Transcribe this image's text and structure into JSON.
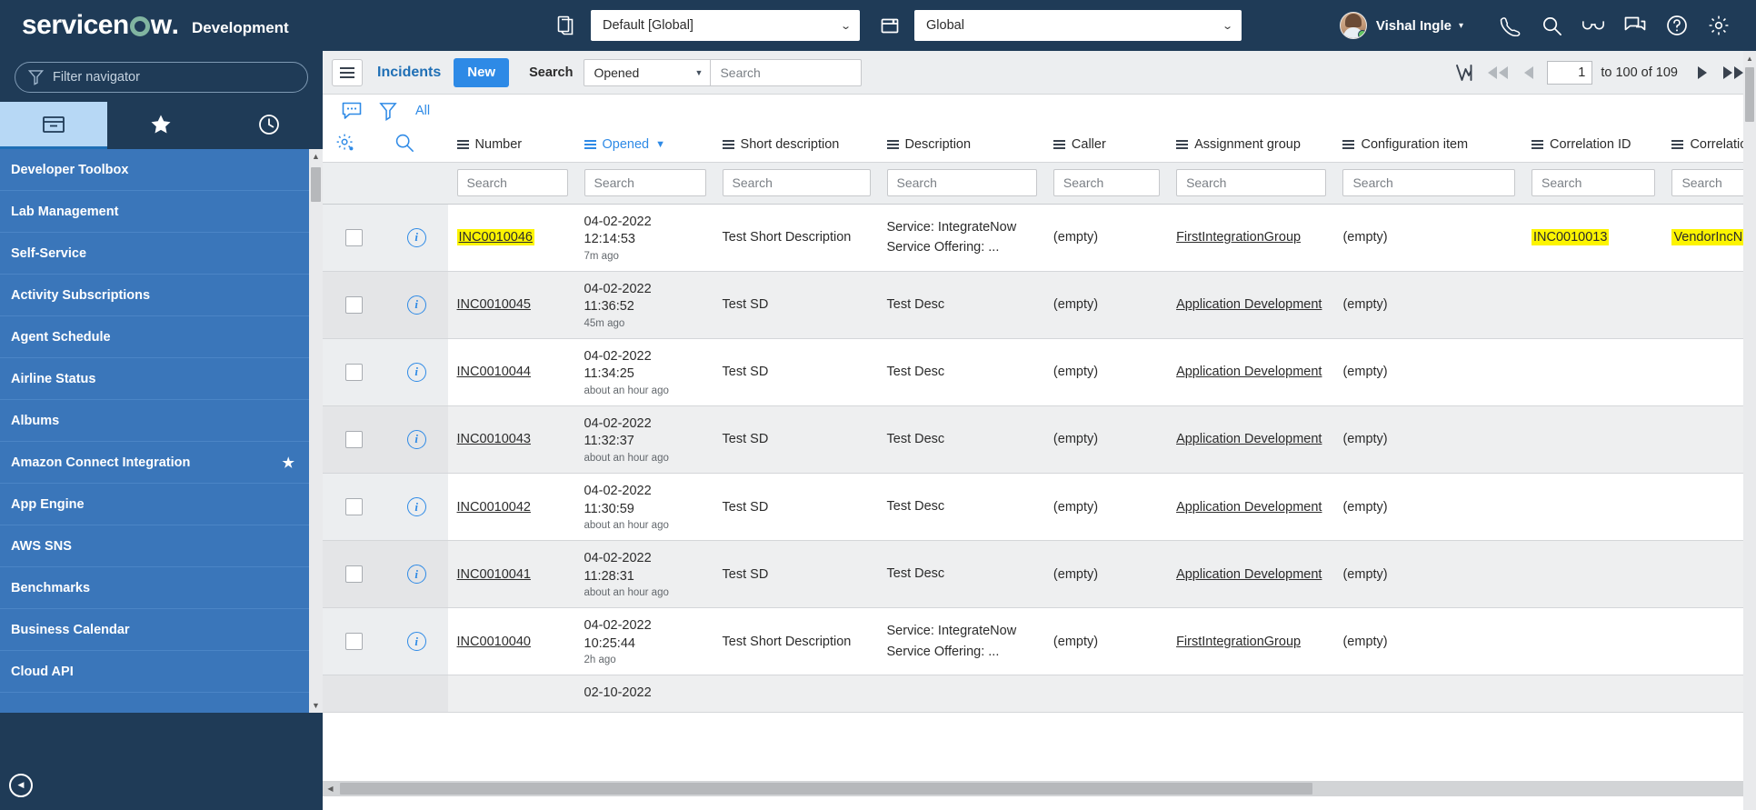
{
  "banner": {
    "brand": "servicenow",
    "instance_label": "Development",
    "app_picker": {
      "value": "Default [Global]",
      "icon": "copy-pages-icon"
    },
    "scope_picker": {
      "value": "Global",
      "icon": "window-icon"
    },
    "user": {
      "name": "Vishal Ingle",
      "presence": "online"
    },
    "icons": [
      "phone-icon",
      "search-icon",
      "glasses-icon",
      "conversation-icon",
      "help-icon",
      "gear-icon"
    ]
  },
  "sidebar": {
    "filter_placeholder": "Filter navigator",
    "tabs": [
      {
        "name": "all-applications",
        "icon": "box-icon",
        "active": true
      },
      {
        "name": "favorites",
        "icon": "star-icon",
        "active": false
      },
      {
        "name": "history",
        "icon": "clock-icon",
        "active": false
      }
    ],
    "items": [
      {
        "label": "Developer Toolbox",
        "favorite": false
      },
      {
        "label": "Lab Management",
        "favorite": false
      },
      {
        "label": "Self-Service",
        "favorite": false
      },
      {
        "label": "Activity Subscriptions",
        "favorite": false
      },
      {
        "label": "Agent Schedule",
        "favorite": false
      },
      {
        "label": "Airline Status",
        "favorite": false
      },
      {
        "label": "Albums",
        "favorite": false
      },
      {
        "label": "Amazon Connect Integration",
        "favorite": true
      },
      {
        "label": "App Engine",
        "favorite": false
      },
      {
        "label": "AWS SNS",
        "favorite": false
      },
      {
        "label": "Benchmarks",
        "favorite": false
      },
      {
        "label": "Business Calendar",
        "favorite": false
      },
      {
        "label": "Cloud API",
        "favorite": false
      }
    ],
    "collapse_label": "◀"
  },
  "toolbar": {
    "menu_icon": "hamburger-icon",
    "title": "Incidents",
    "new_label": "New",
    "search_label": "Search",
    "search_field": "Opened",
    "search_placeholder": "Search",
    "search_value": ""
  },
  "pagination": {
    "chart_icon": "run-chart-icon",
    "page_value": "1",
    "range_text": "to 100 of 109"
  },
  "subbar": {
    "comment_icon": "comment-icon",
    "filter_icon": "funnel-icon",
    "breadcrumb": "All",
    "gear_icon": "personalize-gear-icon",
    "search_icon": "search-icon"
  },
  "table": {
    "columns": [
      {
        "key": "number",
        "label": "Number",
        "sorted": false
      },
      {
        "key": "opened",
        "label": "Opened",
        "sorted": true,
        "sort_dir": "desc"
      },
      {
        "key": "short",
        "label": "Short description",
        "sorted": false
      },
      {
        "key": "desc",
        "label": "Description",
        "sorted": false
      },
      {
        "key": "caller",
        "label": "Caller",
        "sorted": false
      },
      {
        "key": "ag",
        "label": "Assignment group",
        "sorted": false
      },
      {
        "key": "ci",
        "label": "Configuration item",
        "sorted": false
      },
      {
        "key": "cid",
        "label": "Correlation ID",
        "sorted": false
      },
      {
        "key": "cdisp",
        "label": "Correlation display",
        "sorted": false
      }
    ],
    "filter_placeholder": "Search",
    "rows": [
      {
        "number": "INC0010046",
        "number_highlighted": true,
        "date": "04-02-2022",
        "time": "12:14:53",
        "ago": "7m ago",
        "short": "Test Short Description",
        "desc": "Service: IntegrateNow Service Offering: ...",
        "caller": "(empty)",
        "ag": "FirstIntegrationGroup",
        "ag_link": true,
        "ci": "(empty)",
        "cid": "INC0010013",
        "cid_highlighted": true,
        "cdisp": "VendorIncNumber",
        "cdisp_highlighted": true
      },
      {
        "number": "INC0010045",
        "number_highlighted": false,
        "date": "04-02-2022",
        "time": "11:36:52",
        "ago": "45m ago",
        "short": "Test SD",
        "desc": "Test Desc",
        "caller": "(empty)",
        "ag": "Application Development",
        "ag_link": true,
        "ci": "(empty)",
        "cid": "",
        "cdisp": ""
      },
      {
        "number": "INC0010044",
        "number_highlighted": false,
        "date": "04-02-2022",
        "time": "11:34:25",
        "ago": "about an hour ago",
        "short": "Test SD",
        "desc": "Test Desc",
        "caller": "(empty)",
        "ag": "Application Development",
        "ag_link": true,
        "ci": "(empty)",
        "cid": "",
        "cdisp": ""
      },
      {
        "number": "INC0010043",
        "number_highlighted": false,
        "date": "04-02-2022",
        "time": "11:32:37",
        "ago": "about an hour ago",
        "short": "Test SD",
        "desc": "Test Desc",
        "caller": "(empty)",
        "ag": "Application Development",
        "ag_link": true,
        "ci": "(empty)",
        "cid": "",
        "cdisp": ""
      },
      {
        "number": "INC0010042",
        "number_highlighted": false,
        "date": "04-02-2022",
        "time": "11:30:59",
        "ago": "about an hour ago",
        "short": "Test SD",
        "desc": "Test Desc",
        "caller": "(empty)",
        "ag": "Application Development",
        "ag_link": true,
        "ci": "(empty)",
        "cid": "",
        "cdisp": ""
      },
      {
        "number": "INC0010041",
        "number_highlighted": false,
        "date": "04-02-2022",
        "time": "11:28:31",
        "ago": "about an hour ago",
        "short": "Test SD",
        "desc": "Test Desc",
        "caller": "(empty)",
        "ag": "Application Development",
        "ag_link": true,
        "ci": "(empty)",
        "cid": "",
        "cdisp": ""
      },
      {
        "number": "INC0010040",
        "number_highlighted": false,
        "date": "04-02-2022",
        "time": "10:25:44",
        "ago": "2h ago",
        "short": "Test Short Description",
        "desc": "Service: IntegrateNow Service Offering: ...",
        "caller": "(empty)",
        "ag": "FirstIntegrationGroup",
        "ag_link": true,
        "ci": "(empty)",
        "cid": "",
        "cdisp": ""
      }
    ],
    "partial_row": {
      "date": "02-10-2022"
    }
  }
}
